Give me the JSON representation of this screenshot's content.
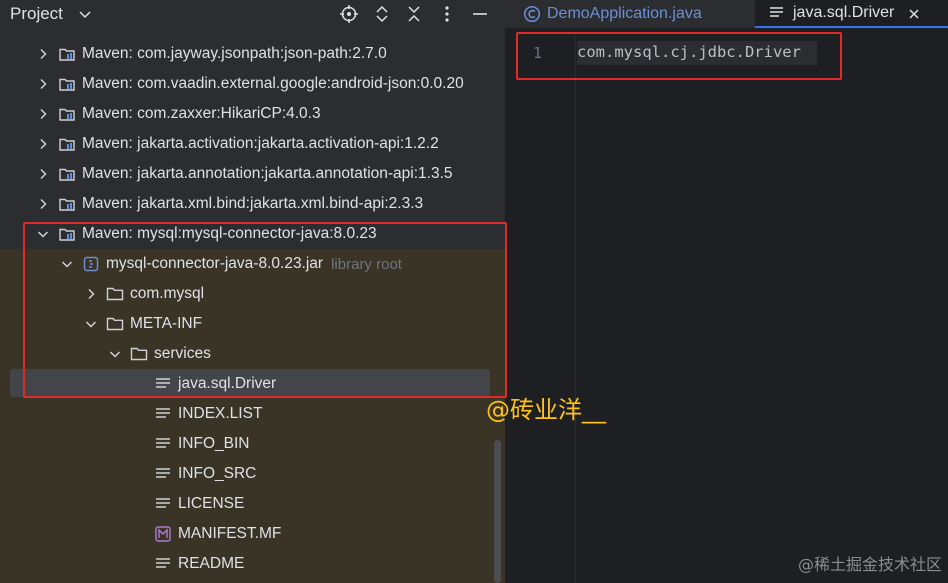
{
  "project_panel": {
    "title": "Project",
    "toolbar_icons": [
      "locate-icon",
      "expand-collapse-icon",
      "collapse-all-icon",
      "more-options-icon",
      "minimize-icon"
    ],
    "tree": [
      {
        "label": "Maven: com.jayway.jsonpath:json-path:2.7.0",
        "icon": "library-icon",
        "state": "collapsed"
      },
      {
        "label": "Maven: com.vaadin.external.google:android-json:0.0.20",
        "icon": "library-icon",
        "state": "collapsed"
      },
      {
        "label": "Maven: com.zaxxer:HikariCP:4.0.3",
        "icon": "library-icon",
        "state": "collapsed"
      },
      {
        "label": "Maven: jakarta.activation:jakarta.activation-api:1.2.2",
        "icon": "library-icon",
        "state": "collapsed"
      },
      {
        "label": "Maven: jakarta.annotation:jakarta.annotation-api:1.3.5",
        "icon": "library-icon",
        "state": "collapsed"
      },
      {
        "label": "Maven: jakarta.xml.bind:jakarta.xml.bind-api:2.3.3",
        "icon": "library-icon",
        "state": "collapsed"
      },
      {
        "label": "Maven: mysql:mysql-connector-java:8.0.23",
        "icon": "library-icon",
        "state": "expanded"
      },
      {
        "label": "mysql-connector-java-8.0.23.jar",
        "suffix": "library root",
        "icon": "jar-icon",
        "state": "expanded"
      },
      {
        "label": "com.mysql",
        "icon": "folder-icon",
        "state": "collapsed"
      },
      {
        "label": "META-INF",
        "icon": "folder-icon",
        "state": "expanded"
      },
      {
        "label": "services",
        "icon": "folder-icon",
        "state": "expanded"
      },
      {
        "label": "java.sql.Driver",
        "icon": "text-file-icon",
        "state": "leaf",
        "selected": true
      },
      {
        "label": "INDEX.LIST",
        "icon": "text-file-icon",
        "state": "leaf"
      },
      {
        "label": "INFO_BIN",
        "icon": "text-file-icon",
        "state": "leaf"
      },
      {
        "label": "INFO_SRC",
        "icon": "text-file-icon",
        "state": "leaf"
      },
      {
        "label": "LICENSE",
        "icon": "text-file-icon",
        "state": "leaf"
      },
      {
        "label": "MANIFEST.MF",
        "icon": "manifest-icon",
        "state": "leaf"
      },
      {
        "label": "README",
        "icon": "text-file-icon",
        "state": "leaf"
      }
    ]
  },
  "editor": {
    "tabs": [
      {
        "label": "DemoApplication.java",
        "icon": "java-class-icon",
        "active": false
      },
      {
        "label": "java.sql.Driver",
        "icon": "text-file-icon",
        "active": true
      }
    ],
    "lines": [
      {
        "number": "1",
        "text": "com.mysql.cj.jdbc.Driver"
      }
    ]
  },
  "overlays": {
    "watermark": "@砖业洋__",
    "corner_watermark": "@稀土掘金技术社区"
  },
  "colors": {
    "panel_bg": "#2b2d30",
    "editor_bg": "#1e1f22",
    "selection_bg": "#43454a",
    "library_highlight": "#3a3426",
    "annotation_red": "#e02b2b",
    "watermark_yellow": "#ffc21a",
    "accent_blue": "#3574f0"
  }
}
